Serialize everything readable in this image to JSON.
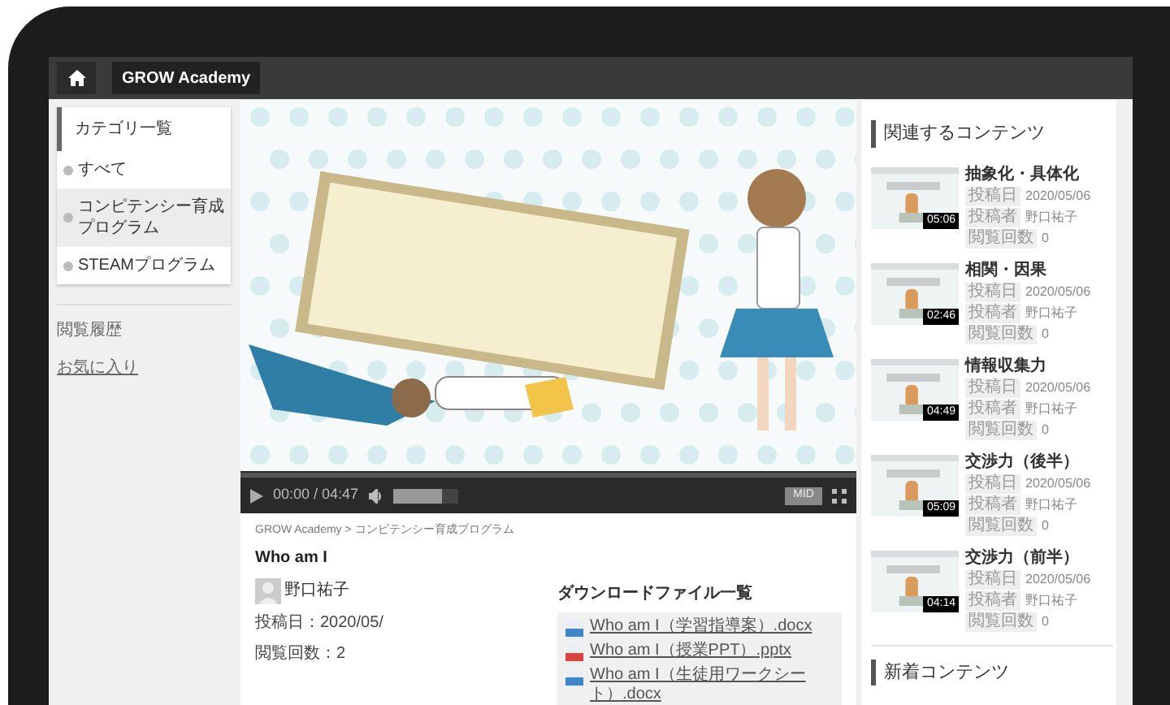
{
  "topbar": {
    "brand": "GROW Academy"
  },
  "sidebar": {
    "heading": "カテゴリ一覧",
    "items": [
      {
        "label": "すべて",
        "selected": false
      },
      {
        "label": "コンピテンシー育成プログラム",
        "selected": true
      },
      {
        "label": "STEAMプログラム",
        "selected": false
      }
    ],
    "links": [
      "閲覧履歴",
      "お気に入り"
    ]
  },
  "player": {
    "time": "00:00 / 04:47",
    "quality": "MID",
    "volume": {
      "level": 0.75
    }
  },
  "info": {
    "breadcrumb": "GROW Academy > コンピテンシー育成プログラム",
    "title": "Who am I",
    "author": "野口祐子",
    "posted": "投稿日：2020/05/",
    "views": "閲覧回数：2",
    "downloads_heading": "ダウンロードファイル一覧",
    "files": [
      {
        "kind": "docx",
        "name": "Who am I（学習指導案）.docx"
      },
      {
        "kind": "pptx",
        "name": "Who am I（授業PPT）.pptx"
      },
      {
        "kind": "docx",
        "name": "Who am I（生徒用ワークシート）.docx"
      }
    ]
  },
  "related": {
    "heading": "関連するコンテンツ",
    "items": [
      {
        "title": "抽象化・具体化",
        "duration": "05:06",
        "meta": [
          {
            "label": "投稿日",
            "value": "2020/05/06"
          },
          {
            "label": "投稿者",
            "value": "野口祐子"
          },
          {
            "label": "閲覧回数",
            "value": "0"
          }
        ]
      },
      {
        "title": "相関・因果",
        "duration": "02:46",
        "meta": [
          {
            "label": "投稿日",
            "value": "2020/05/06"
          },
          {
            "label": "投稿者",
            "value": "野口祐子"
          },
          {
            "label": "閲覧回数",
            "value": "0"
          }
        ]
      },
      {
        "title": "情報収集力",
        "duration": "04:49",
        "meta": [
          {
            "label": "投稿日",
            "value": "2020/05/06"
          },
          {
            "label": "投稿者",
            "value": "野口祐子"
          },
          {
            "label": "閲覧回数",
            "value": "0"
          }
        ]
      },
      {
        "title": "交渉力（後半）",
        "duration": "05:09",
        "meta": [
          {
            "label": "投稿日",
            "value": "2020/05/06"
          },
          {
            "label": "投稿者",
            "value": "野口祐子"
          },
          {
            "label": "閲覧回数",
            "value": "0"
          }
        ]
      },
      {
        "title": "交渉力（前半）",
        "duration": "04:14",
        "meta": [
          {
            "label": "投稿日",
            "value": "2020/05/06"
          },
          {
            "label": "投稿者",
            "value": "野口祐子"
          },
          {
            "label": "閲覧回数",
            "value": "0"
          }
        ]
      }
    ]
  },
  "new_heading": "新着コンテンツ"
}
